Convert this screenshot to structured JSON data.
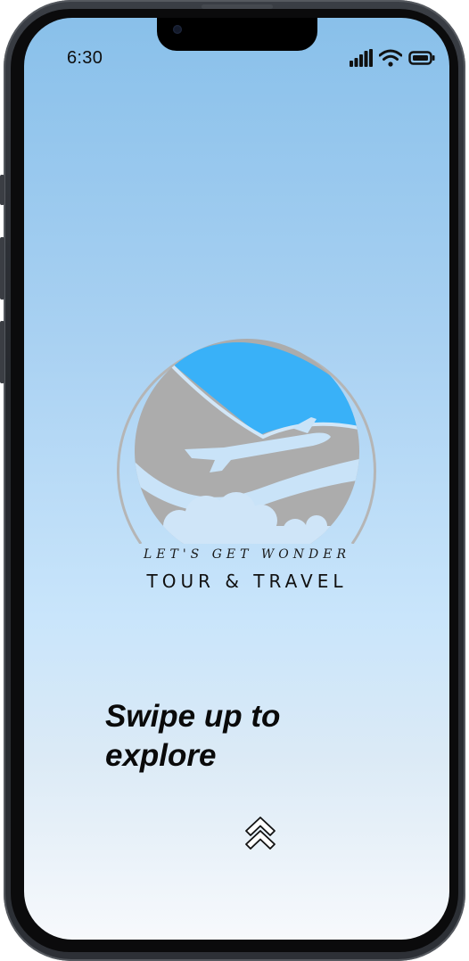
{
  "status_bar": {
    "time": "6:30",
    "icons": [
      "signal-icon",
      "wifi-icon",
      "battery-icon"
    ]
  },
  "logo": {
    "tagline": "LET'S GET WONDER",
    "brand": "TOUR & TRAVEL",
    "icon": "airplane-over-clouds-logo"
  },
  "main": {
    "swipe_line1": "Swipe up to",
    "swipe_line2": "explore",
    "swipe_icon": "double-chevron-up-icon"
  },
  "colors": {
    "sky_blue": "#3bb0f7",
    "logo_gray": "#aaaaaa",
    "cloud_light": "#c9e3f8",
    "bg_top": "#89c0ea",
    "bg_bottom": "#f7f9fc"
  }
}
